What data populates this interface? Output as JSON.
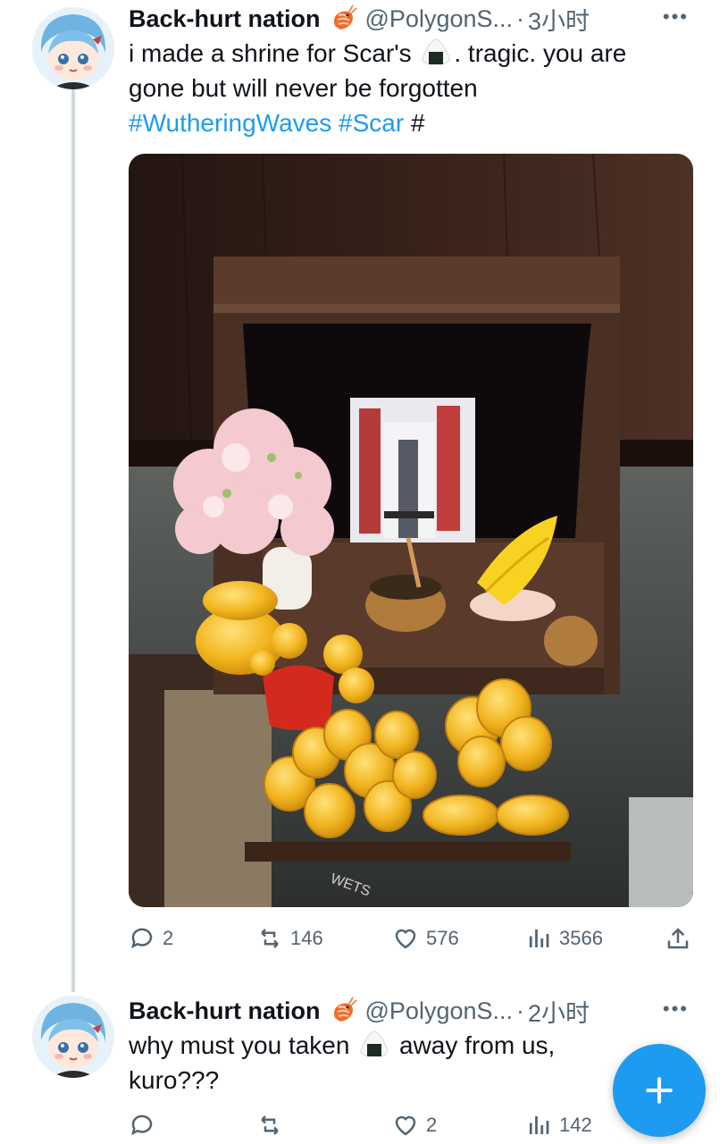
{
  "tweets": [
    {
      "name": "Back-hurt nation",
      "handle": "@PolygonS...",
      "dot": "·",
      "time": "3小时",
      "text_pre": "i made a shrine for Scar's",
      "text_post": ". tragic. you are",
      "text_line2": "gone but will never be forgotten",
      "hashtag1": "#WutheringWaves",
      "hashtag2": "#Scar",
      "hashtag3": "#",
      "stats": {
        "replies": "2",
        "retweets": "146",
        "likes": "576",
        "views": "3566"
      }
    },
    {
      "name": "Back-hurt nation",
      "handle": "@PolygonS...",
      "dot": "·",
      "time": "2小时",
      "text_pre": "why must you taken",
      "text_post": "away from us,",
      "text_line2": "kuro???",
      "stats": {
        "likes": "2",
        "views": "142"
      }
    }
  ],
  "photo": {
    "box_label": "WETS"
  },
  "icons": [
    "avatar",
    "shrimp-emoji",
    "onigiri-emoji",
    "more-icon",
    "reply-icon",
    "retweet-icon",
    "like-icon",
    "views-icon",
    "share-icon",
    "compose-icon"
  ],
  "colors": {
    "accent": "#1d9bf0",
    "muted": "#536471",
    "text": "#0f1419"
  }
}
